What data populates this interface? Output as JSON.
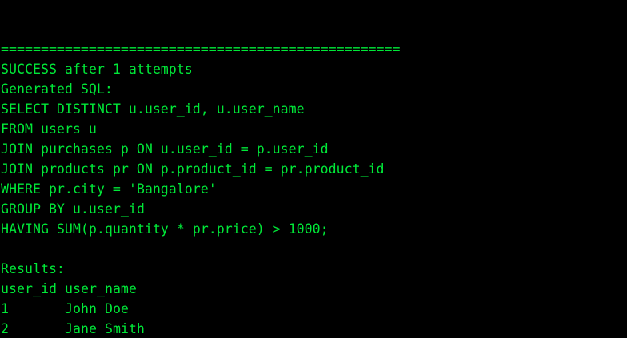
{
  "terminal": {
    "text_color": "#00e838",
    "background": "#000000",
    "separator": "==================================================",
    "status": "SUCCESS after 1 attempts",
    "sql_header": "Generated SQL:",
    "sql_lines": [
      "SELECT DISTINCT u.user_id, u.user_name",
      "FROM users u",
      "JOIN purchases p ON u.user_id = p.user_id",
      "JOIN products pr ON p.product_id = pr.product_id",
      "WHERE pr.city = 'Bangalore'",
      "GROUP BY u.user_id",
      "HAVING SUM(p.quantity * pr.price) > 1000;"
    ],
    "results_header": "Results:",
    "results_columns": [
      "user_id",
      "user_name"
    ],
    "results_rows": [
      [
        "1",
        "John Doe"
      ],
      [
        "2",
        "Jane Smith"
      ]
    ]
  }
}
